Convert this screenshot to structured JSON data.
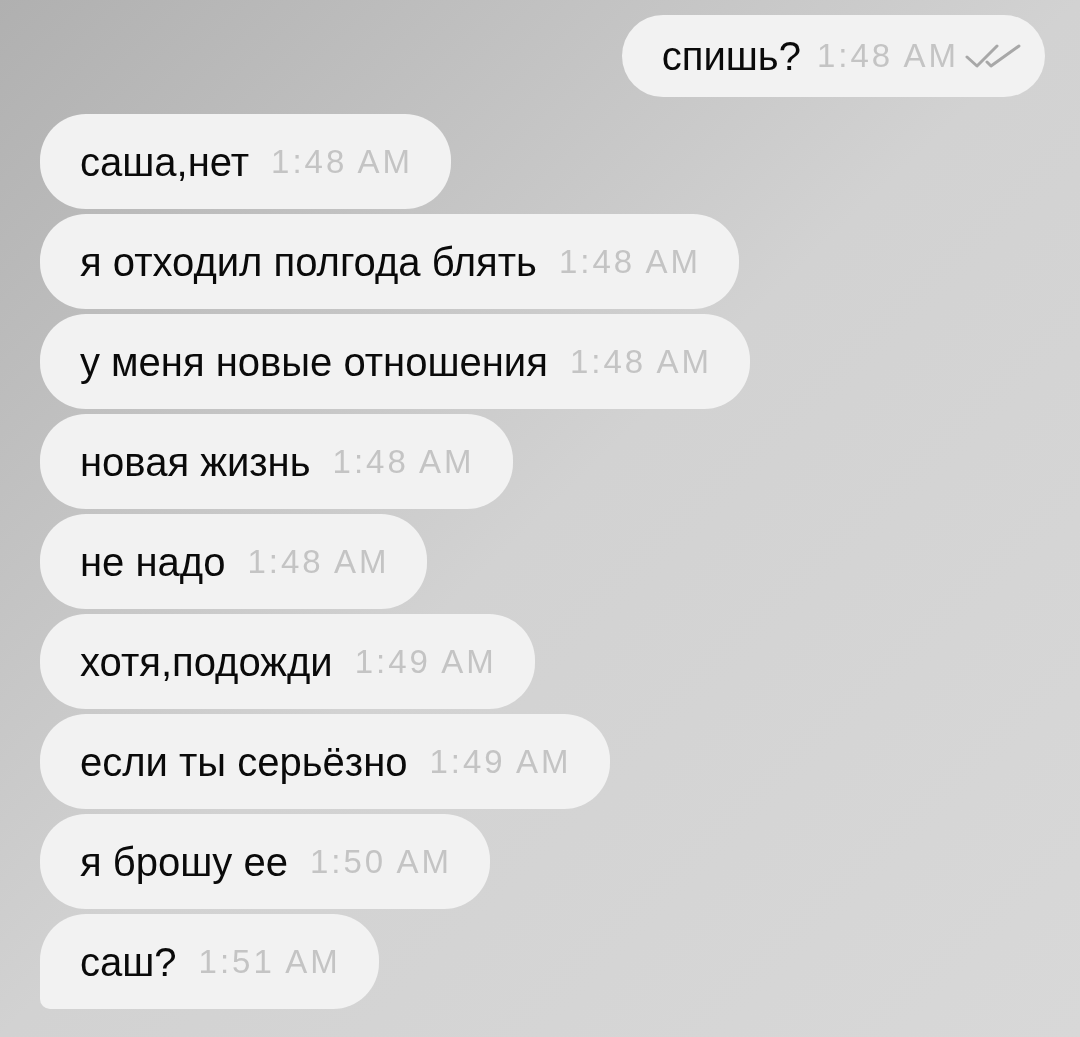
{
  "messages": [
    {
      "kind": "outgoing",
      "text": "спишь?",
      "time": "1:48 AM",
      "read": true
    },
    {
      "kind": "incoming",
      "text": "саша,нет",
      "time": "1:48 AM"
    },
    {
      "kind": "incoming",
      "text": "я отходил полгода блять",
      "time": "1:48 AM"
    },
    {
      "kind": "incoming",
      "text": "у меня новые отношения",
      "time": "1:48 AM"
    },
    {
      "kind": "incoming",
      "text": "новая жизнь",
      "time": "1:48 AM"
    },
    {
      "kind": "incoming",
      "text": "не надо",
      "time": "1:48 AM"
    },
    {
      "kind": "incoming",
      "text": "хотя,подожди",
      "time": "1:49 AM"
    },
    {
      "kind": "incoming",
      "text": "если ты серьёзно",
      "time": "1:49 AM"
    },
    {
      "kind": "incoming",
      "text": "я брошу ее",
      "time": "1:50 AM"
    },
    {
      "kind": "incoming",
      "text": "саш?",
      "time": "1:51 AM"
    }
  ]
}
